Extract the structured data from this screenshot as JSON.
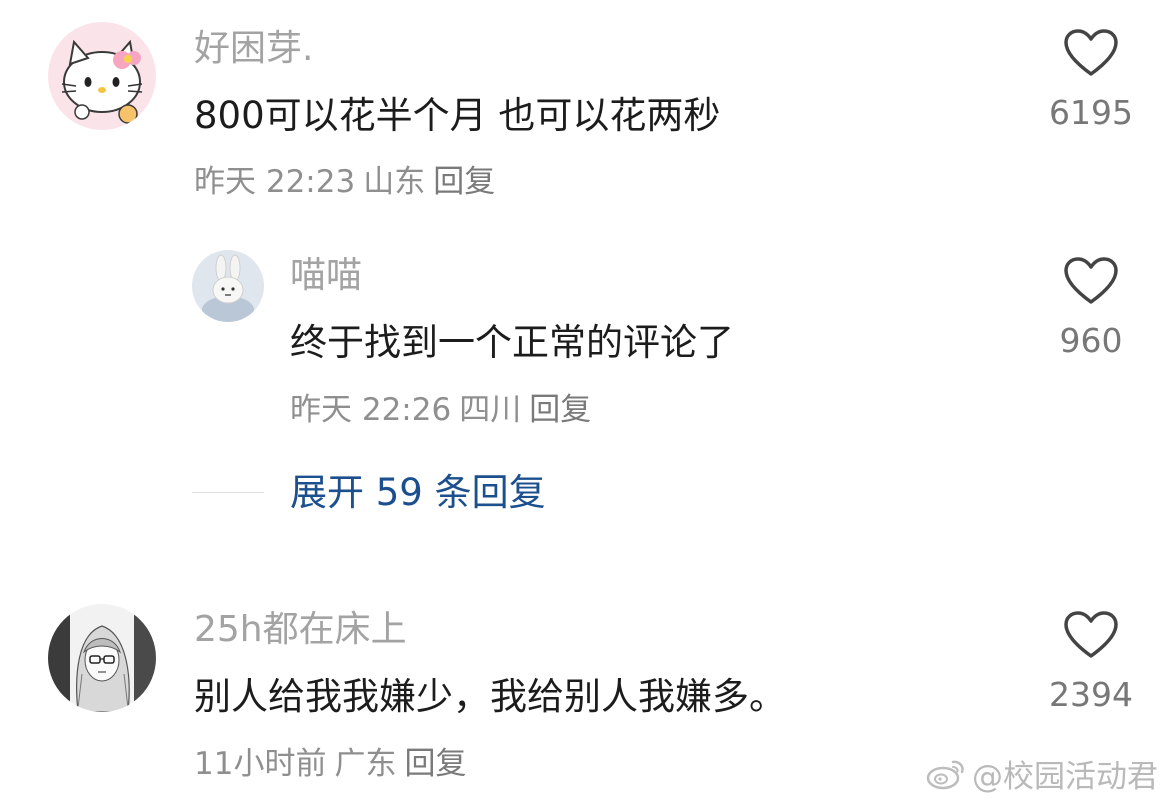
{
  "comments": [
    {
      "username": "好困芽.",
      "content": "800可以花半个月 也可以花两秒",
      "time": "昨天 22:23",
      "location": "山东",
      "reply_label": "回复",
      "likes": "6195",
      "avatar_icon": "hello-kitty-avatar",
      "replies": [
        {
          "username": "喵喵",
          "content": "终于找到一个正常的评论了",
          "time": "昨天 22:26",
          "location": "四川",
          "reply_label": "回复",
          "likes": "960",
          "avatar_icon": "bunny-plush-avatar"
        }
      ],
      "expand_label": "展开 59 条回复"
    },
    {
      "username": "25h都在床上",
      "content": "别人给我我嫌少，我给别人我嫌多。",
      "time": "11小时前",
      "location": "广东",
      "reply_label": "回复",
      "likes": "2394",
      "avatar_icon": "manga-girl-avatar"
    }
  ],
  "watermark": "@校园活动君",
  "colors": {
    "expand_link": "#1c4f8e",
    "username": "#a3a3a3",
    "meta": "#8f8f8f"
  }
}
